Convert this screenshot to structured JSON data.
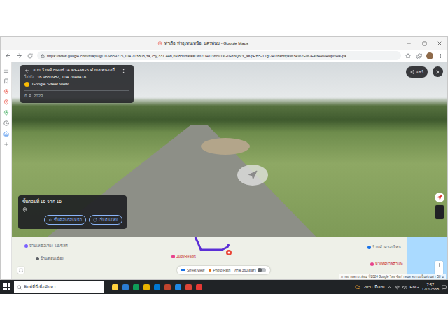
{
  "browser": {
    "title": "ท่าเรือ ท่าอุเทนเหนือ, นครพนม - Google Maps",
    "url": "https://www.google.com/maps/@16.9659215,104.703803,3a,75y,331.44h,69.83t/data=!3m7!1e1!3m5!1sGuProQ6tY_sKpEzI5-T7g!2e0!6shttps%3A%2F%2Fstreetviewpixels-pa"
  },
  "street_view": {
    "from": "จาก ร้านค้าของชำ 4JPF+MG5 ตำบล หนองมี...",
    "to_label": "ไปยัง",
    "to": "16.9661982, 104.7040418",
    "source": "Google Street View",
    "date": "ก.ค. 2023",
    "share": "แชร์"
  },
  "steps": {
    "title": "ขั้นตอนที่ 16 จาก 16",
    "buttons": [
      {
        "label": "ขั้นตอนก่อนหน้า",
        "kind": "back"
      },
      {
        "label": "เริ่มต้นใหม่",
        "kind": "restart"
      }
    ]
  },
  "map": {
    "labels": [
      "บ้านเหนือเรียง ไฮเซลท์",
      "บ้านดอนเมือง",
      "JudyResort",
      "ร้านค้าครอบไหน",
      "ห้าเทศบาลต้าแพ"
    ],
    "layers": [
      {
        "label": "Street View",
        "kind": "line"
      },
      {
        "label": "Photo Path",
        "kind": "dot"
      },
      {
        "label": "ภาพ 360 องศา",
        "kind": "switch",
        "on": false
      }
    ],
    "footer": "ภาพถ่ายดาวเทียม ©2024 Google ไทย ข้อกำหนด ความเป็นส่วนตัว 50 ม."
  },
  "taskbar": {
    "search": "พิมพ์ที่นี่เพื่อค้นหา",
    "weather": "20°C มีเมฆ",
    "lang": "ENG",
    "time": "7:57",
    "date": "12/2/2568"
  }
}
